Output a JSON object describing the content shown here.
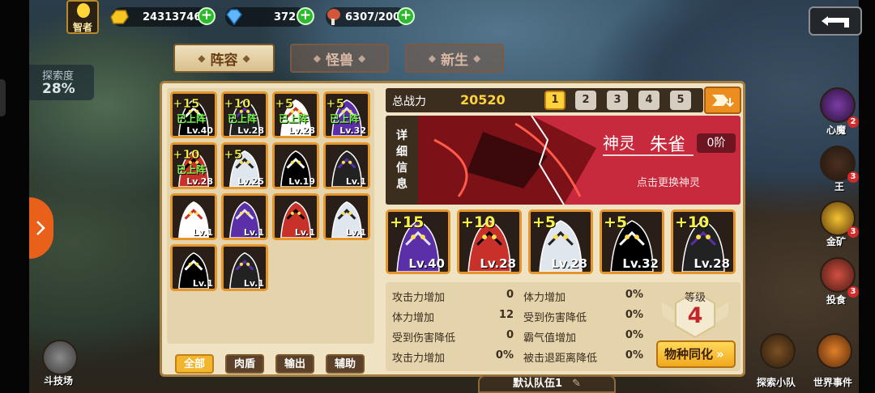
{
  "hud": {
    "hero_title": "智者",
    "gold": "24313746",
    "gems": "372",
    "food": "6307/200",
    "explore_label": "探索度",
    "explore_value": "28%"
  },
  "tabs": [
    {
      "label": "阵容",
      "active": true
    },
    {
      "label": "怪兽",
      "active": false
    },
    {
      "label": "新生",
      "active": false
    }
  ],
  "roster": [
    {
      "star": "+15",
      "status": "已上阵",
      "level": "Lv.40"
    },
    {
      "star": "+10",
      "status": "已上阵",
      "level": "Lv.28"
    },
    {
      "star": "+5",
      "status": "已上阵",
      "level": "Lv.28"
    },
    {
      "star": "+5",
      "status": "已上阵",
      "level": "Lv.32"
    },
    {
      "star": "+10",
      "status": "已上阵",
      "level": "Lv.28"
    },
    {
      "star": "+5",
      "status": "",
      "level": "Lv.25"
    },
    {
      "star": "",
      "status": "",
      "level": "Lv.19"
    },
    {
      "star": "",
      "status": "",
      "level": "Lv.1"
    },
    {
      "star": "",
      "status": "",
      "level": "Lv.1"
    },
    {
      "star": "",
      "status": "",
      "level": "Lv.1"
    },
    {
      "star": "",
      "status": "",
      "level": "Lv.1"
    },
    {
      "star": "",
      "status": "",
      "level": "Lv.1"
    },
    {
      "star": "",
      "status": "",
      "level": "Lv.1"
    },
    {
      "star": "",
      "status": "",
      "level": "Lv.1"
    }
  ],
  "filters": [
    "全部",
    "肉盾",
    "输出",
    "辅助"
  ],
  "power": {
    "label": "总战力",
    "value": "20520"
  },
  "team_slots": [
    "1",
    "2",
    "3",
    "4",
    "5"
  ],
  "god": {
    "detail_chars": [
      "详",
      "细",
      "信",
      "息"
    ],
    "type": "神灵",
    "name": "朱雀",
    "rank": "0阶",
    "hint": "点击更换神灵"
  },
  "lineup": [
    {
      "star": "+15",
      "level": "Lv.40"
    },
    {
      "star": "+10",
      "level": "Lv.28"
    },
    {
      "star": "+5",
      "level": "Lv.28"
    },
    {
      "star": "+5",
      "level": "Lv.32"
    },
    {
      "star": "+10",
      "level": "Lv.28"
    }
  ],
  "stats": [
    {
      "label": "攻击力增加",
      "value": "0"
    },
    {
      "label": "体力增加",
      "value": "0%"
    },
    {
      "label": "体力增加",
      "value": "12"
    },
    {
      "label": "受到伤害降低",
      "value": "0%"
    },
    {
      "label": "受到伤害降低",
      "value": "0"
    },
    {
      "label": "霸气值增加",
      "value": "0%"
    },
    {
      "label": "攻击力增加",
      "value": "0%"
    },
    {
      "label": "被击退距离降低",
      "value": "0%"
    }
  ],
  "level": {
    "label": "等级",
    "value": "4"
  },
  "assimilate_label": "物种同化",
  "team_name": "默认队伍1",
  "side": {
    "left_bottom": "斗技场",
    "right_items": [
      {
        "label": "心魔",
        "badge": "2"
      },
      {
        "label": "王",
        "badge": "3"
      },
      {
        "label": "金矿",
        "badge": "3"
      },
      {
        "label": "投食",
        "badge": "3"
      }
    ],
    "bottom_right": [
      "探索小队",
      "世界事件"
    ]
  },
  "colors": {
    "accent": "#e5962b",
    "god_bg": "#c7293d",
    "power": "#ffd23c"
  }
}
